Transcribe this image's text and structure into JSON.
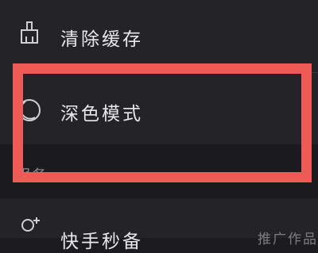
{
  "settings": {
    "items": [
      {
        "label": "清除缓存",
        "icon": "broom-icon"
      },
      {
        "label": "深色模式",
        "icon": "moon-icon"
      }
    ],
    "section_title": "服务",
    "kuai_item": {
      "label": "快手秒备",
      "icon": "sparkle-user-icon",
      "right_text": "推广作品"
    }
  },
  "colors": {
    "background": "#1c1c20",
    "row_background": "#232328",
    "text": "#e8e8ec",
    "highlight": "#ee5a55"
  }
}
